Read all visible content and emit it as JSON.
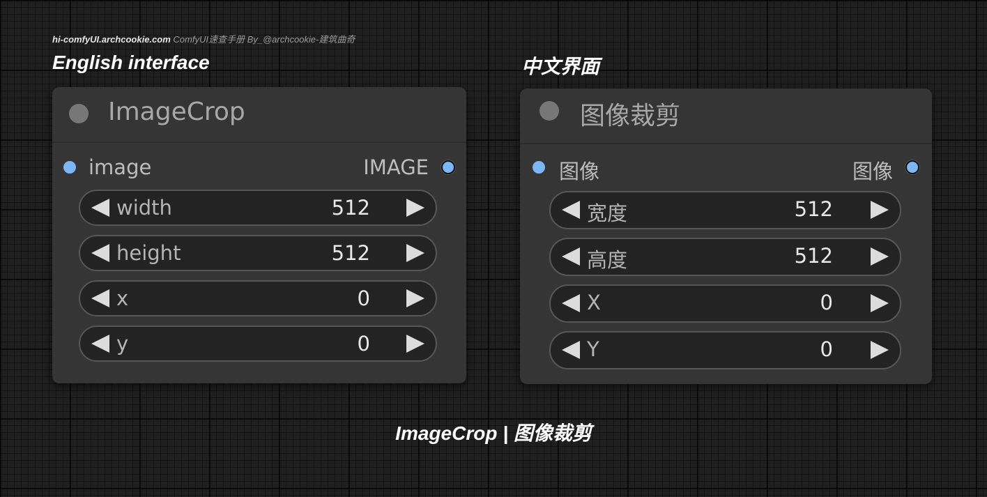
{
  "credit": {
    "site": "hi-comfyUI.archcookie.com",
    "rest": " ComfyUI速查手册  By_@archcookie-建筑曲奇"
  },
  "labels": {
    "english": "English interface",
    "chinese": "中文界面"
  },
  "english_node": {
    "title": "ImageCrop",
    "input_label": "image",
    "output_label": "IMAGE",
    "widgets": [
      {
        "label": "width",
        "value": "512"
      },
      {
        "label": "height",
        "value": "512"
      },
      {
        "label": "x",
        "value": "0"
      },
      {
        "label": "y",
        "value": "0"
      }
    ]
  },
  "chinese_node": {
    "title": "图像裁剪",
    "input_label": "图像",
    "output_label": "图像",
    "widgets": [
      {
        "label": "宽度",
        "value": "512"
      },
      {
        "label": "高度",
        "value": "512"
      },
      {
        "label": "X",
        "value": "0"
      },
      {
        "label": "Y",
        "value": "0"
      }
    ]
  },
  "caption": "ImageCrop | 图像裁剪",
  "colors": {
    "slot": "#7db6f5",
    "node_bg": "#353535",
    "widget_bg": "#232323"
  }
}
